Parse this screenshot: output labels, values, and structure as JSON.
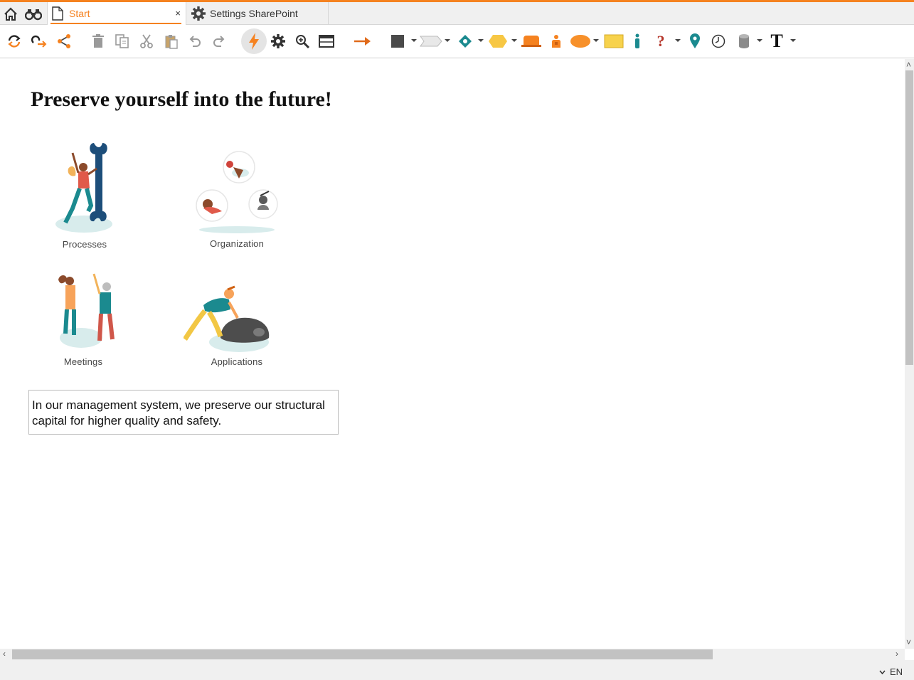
{
  "tabs": {
    "home_icon": "home-icon",
    "search_icon": "binoculars-icon",
    "start": {
      "label": "Start",
      "close": "×"
    },
    "settings": {
      "label": "Settings SharePoint"
    }
  },
  "toolbar": {
    "icons": [
      "refresh-icon",
      "redo-step-icon",
      "share-icon",
      "delete-icon",
      "copy-icon",
      "cut-icon",
      "paste-icon",
      "undo-icon",
      "redo-icon",
      "lightning-icon",
      "gear-icon",
      "zoom-icon",
      "window-icon",
      "arrow-icon",
      "rectangle-shape-icon",
      "chevron-shape-icon",
      "diamond-shape-icon",
      "hexagon-shape-icon",
      "role-shape-icon",
      "person-shape-icon",
      "ellipse-shape-icon",
      "note-shape-icon",
      "user-shape-icon",
      "question-shape-icon",
      "location-pin-icon",
      "clock-icon",
      "database-icon",
      "text-tool-icon"
    ],
    "text_tool_glyph": "T",
    "question_glyph": "?"
  },
  "page": {
    "heading": "Preserve yourself into the future!",
    "tiles": [
      {
        "caption": "Processes"
      },
      {
        "caption": "Organization"
      },
      {
        "caption": "Meetings"
      },
      {
        "caption": "Applications"
      }
    ],
    "textbox": "In our management system, we preserve our structural capital for higher quality and safety."
  },
  "status": {
    "language": "EN"
  },
  "colors": {
    "accent": "#f58220",
    "teal": "#1b8a8f",
    "navy": "#1d4e7a"
  }
}
